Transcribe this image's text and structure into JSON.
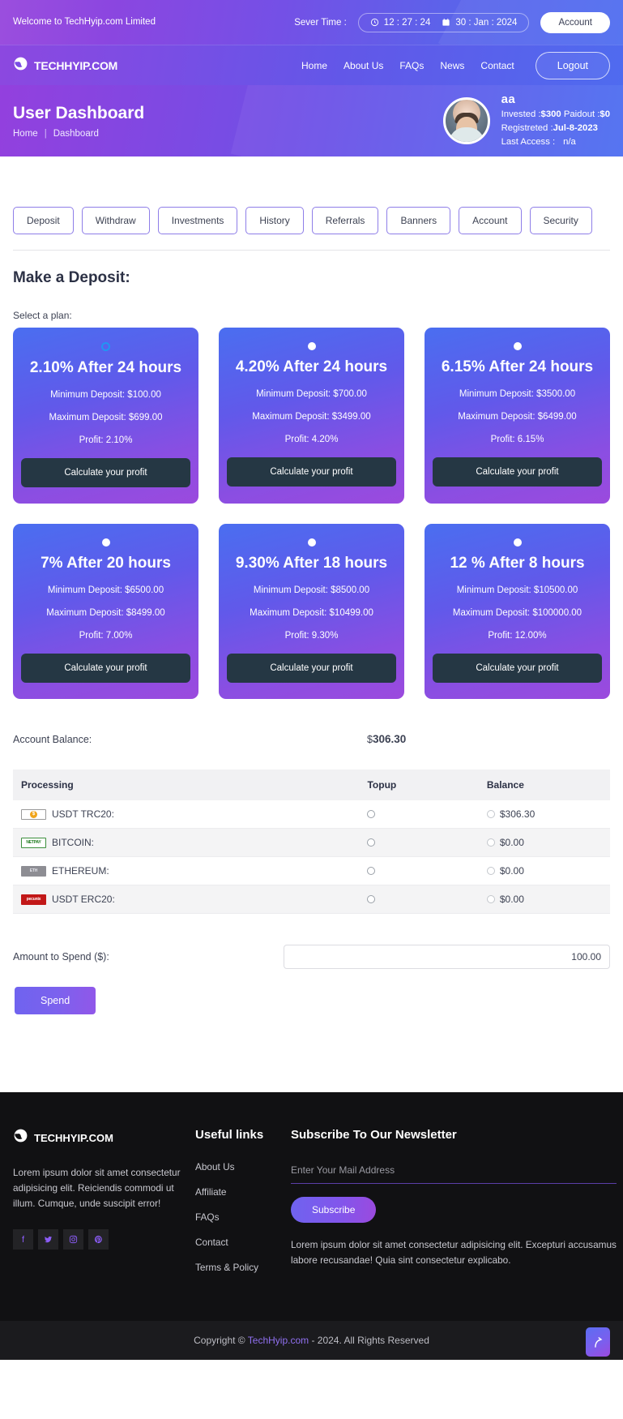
{
  "topbar": {
    "welcome": "Welcome to TechHyip.com Limited",
    "server_time_label": "Sever Time :",
    "time": "12 : 27 : 24",
    "date": "30 : Jan : 2024",
    "account_button": "Account",
    "clock_icon": "clock-icon",
    "calendar_icon": "calendar-icon"
  },
  "nav": {
    "brand": "TECHHYIP.COM",
    "links": [
      {
        "label": "Home"
      },
      {
        "label": "About Us"
      },
      {
        "label": "FAQs"
      },
      {
        "label": "News"
      },
      {
        "label": "Contact"
      }
    ],
    "logout": "Logout"
  },
  "banner": {
    "title": "User Dashboard",
    "crumb_home": "Home",
    "crumb_sep": "|",
    "crumb_current": "Dashboard",
    "user": {
      "name": "aa",
      "invested_label": "Invested :",
      "invested_value": "$300",
      "paidout_label": "Paidout :",
      "paidout_value": "$0",
      "registered_label": "Registreted :",
      "registered_value": "Jul-8-2023",
      "last_access_label": "Last Access :",
      "last_access_value": "n/a"
    }
  },
  "tabs": [
    {
      "label": "Deposit"
    },
    {
      "label": "Withdraw"
    },
    {
      "label": "Investments"
    },
    {
      "label": "History"
    },
    {
      "label": "Referrals"
    },
    {
      "label": "Banners"
    },
    {
      "label": "Account"
    },
    {
      "label": "Security"
    }
  ],
  "deposit": {
    "heading": "Make a Deposit:",
    "select_plan_label": "Select a plan:",
    "plans": [
      {
        "rate": "2.10% After 24 hours",
        "minimum": "Minimum Deposit: $100.00",
        "maximum": "Maximum Deposit: $699.00",
        "profit": "Profit: 2.10%",
        "button": "Calculate your profit",
        "selected": true
      },
      {
        "rate": "4.20% After 24 hours",
        "minimum": "Minimum Deposit: $700.00",
        "maximum": "Maximum Deposit: $3499.00",
        "profit": "Profit: 4.20%",
        "button": "Calculate your profit",
        "selected": false
      },
      {
        "rate": "6.15% After 24 hours",
        "minimum": "Minimum Deposit: $3500.00",
        "maximum": "Maximum Deposit: $6499.00",
        "profit": "Profit: 6.15%",
        "button": "Calculate your profit",
        "selected": false
      },
      {
        "rate": "7% After 20 hours",
        "minimum": "Minimum Deposit: $6500.00",
        "maximum": "Maximum Deposit: $8499.00",
        "profit": "Profit: 7.00%",
        "button": "Calculate your profit",
        "selected": false
      },
      {
        "rate": "9.30% After 18 hours",
        "minimum": "Minimum Deposit: $8500.00",
        "maximum": "Maximum Deposit: $10499.00",
        "profit": "Profit: 9.30%",
        "button": "Calculate your profit",
        "selected": false
      },
      {
        "rate": "12 % After 8 hours",
        "minimum": "Minimum Deposit: $10500.00",
        "maximum": "Maximum Deposit: $100000.00",
        "profit": "Profit: 12.00%",
        "button": "Calculate your profit",
        "selected": false
      }
    ],
    "balance_label": "Account Balance:",
    "balance_currency": "$",
    "balance_amount": "306.30",
    "table": {
      "headers": [
        "Processing",
        "Topup",
        "Balance"
      ],
      "rows": [
        {
          "name": "USDT TRC20:",
          "logo": "usdt-trc20-logo",
          "logo_text": "",
          "topup": "",
          "balance": "$306.30"
        },
        {
          "name": "BITCOIN:",
          "logo": "netpay-logo",
          "logo_text": "NETPAY",
          "topup": "",
          "balance": "$0.00"
        },
        {
          "name": "ETHEREUM:",
          "logo": "ethereum-logo",
          "logo_text": "ETH",
          "topup": "",
          "balance": "$0.00"
        },
        {
          "name": "USDT ERC20:",
          "logo": "pecunix-logo",
          "logo_text": "pecunix",
          "topup": "",
          "balance": "$0.00"
        }
      ]
    },
    "amount_label": "Amount to Spend ($):",
    "amount_value": "100.00",
    "amount_placeholder": "100.00",
    "spend_button": "Spend"
  },
  "footer": {
    "brand": "TECHHYIP.COM",
    "description": "Lorem ipsum dolor sit amet consectetur adipisicing elit. Reiciendis commodi ut illum. Cumque, unde suscipit error!",
    "socials": [
      {
        "name": "facebook-icon",
        "glyph": "f"
      },
      {
        "name": "twitter-icon",
        "glyph": "ᵗ"
      },
      {
        "name": "instagram-icon",
        "glyph": "▢"
      },
      {
        "name": "pinterest-icon",
        "glyph": "P"
      }
    ],
    "useful_links_title": "Useful links",
    "useful_links": [
      {
        "label": "About Us"
      },
      {
        "label": "Affiliate"
      },
      {
        "label": "FAQs"
      },
      {
        "label": "Contact"
      },
      {
        "label": "Terms & Policy"
      }
    ],
    "newsletter_title": "Subscribe To Our Newsletter",
    "newsletter_placeholder": "Enter Your Mail Address",
    "newsletter_value": "",
    "subscribe_button": "Subscribe",
    "newsletter_desc": "Lorem ipsum dolor sit amet consectetur adipisicing elit. Excepturi accusamus labore recusandae! Quia sint consectetur explicabo.",
    "copyright_prefix": "Copyright © ",
    "copyright_link": "TechHyip.com",
    "copyright_suffix": " - 2024. All Rights Reserved",
    "to_top_icon": "arrow-up-icon"
  },
  "colors": {
    "accent_purple": "#8b4ee2",
    "accent_blue": "#4d6ef1",
    "dark_button": "#253744",
    "footer_bg": "#111113"
  }
}
